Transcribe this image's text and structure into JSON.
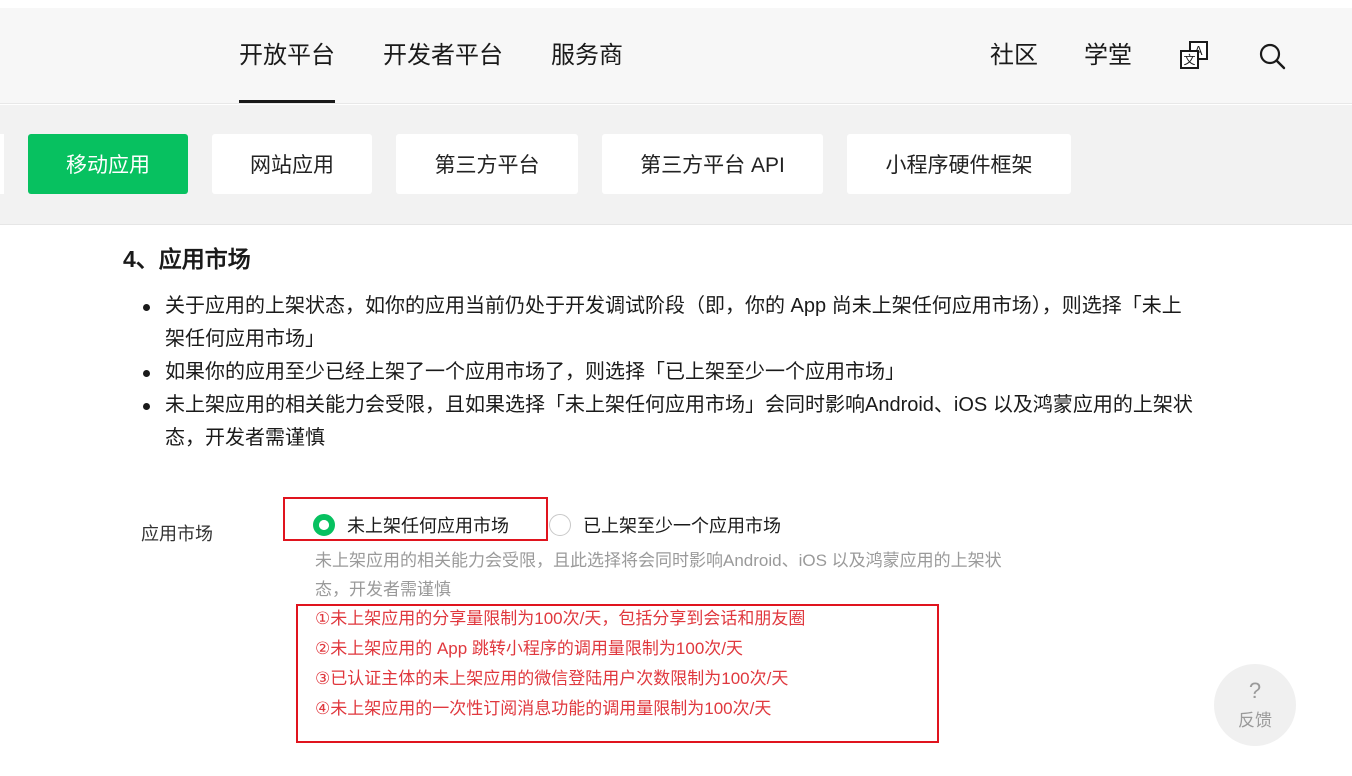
{
  "header": {
    "nav_left": [
      "开放平台",
      "开发者平台",
      "服务商"
    ],
    "active_index": 0,
    "nav_right": [
      "社区",
      "学堂"
    ],
    "icons": [
      "translate-icon",
      "search-icon"
    ]
  },
  "subnav": {
    "tabs": [
      "移动应用",
      "网站应用",
      "第三方平台",
      "第三方平台 API",
      "小程序硬件框架"
    ],
    "active_index": 0
  },
  "section": {
    "title": "4、应用市场",
    "bullets": [
      "关于应用的上架状态，如你的应用当前仍处于开发调试阶段（即，你的 App 尚未上架任何应用市场），则选择「未上架任何应用市场」",
      "如果你的应用至少已经上架了一个应用市场了，则选择「已上架至少一个应用市场」",
      "未上架应用的相关能力会受限，且如果选择「未上架任何应用市场」会同时影响Android、iOS 以及鸿蒙应用的上架状态，开发者需谨慎"
    ]
  },
  "form": {
    "label": "应用市场",
    "options": [
      "未上架任何应用市场",
      "已上架至少一个应用市场"
    ],
    "selected_index": 0,
    "hint": "未上架应用的相关能力会受限，且此选择将会同时影响Android、iOS 以及鸿蒙应用的上架状态，开发者需谨慎",
    "notes": [
      "①未上架应用的分享量限制为100次/天，包括分享到会话和朋友圈",
      "②未上架应用的 App 跳转小程序的调用量限制为100次/天",
      "③已认证主体的未上架应用的微信登陆用户次数限制为100次/天",
      "④未上架应用的一次性订阅消息功能的调用量限制为100次/天"
    ]
  },
  "feedback": {
    "symbol": "?",
    "label": "反馈"
  },
  "colors": {
    "accent": "#07c160",
    "annotation_red": "#e0141e",
    "note_red": "#e0383e"
  }
}
